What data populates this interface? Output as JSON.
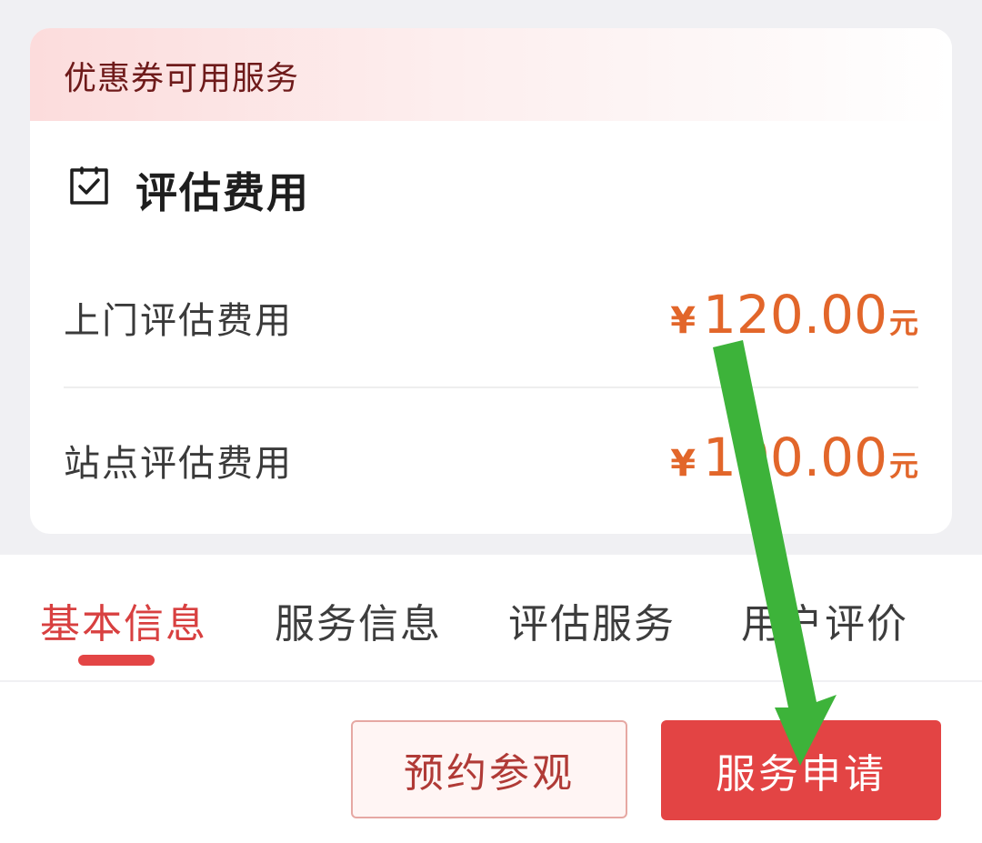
{
  "coupon_section": {
    "title": "优惠券可用服务"
  },
  "fee_section": {
    "icon": "checkbox-checked-icon",
    "title": "评估费用",
    "rows": [
      {
        "label": "上门评估费用",
        "currency": "¥",
        "amount": "120.00",
        "unit": "元"
      },
      {
        "label": "站点评估费用",
        "currency": "¥",
        "amount": "100.00",
        "unit": "元"
      }
    ]
  },
  "tabs": [
    {
      "label": "基本信息",
      "active": true
    },
    {
      "label": "服务信息",
      "active": false
    },
    {
      "label": "评估服务",
      "active": false
    },
    {
      "label": "用户评价",
      "active": false
    }
  ],
  "actions": {
    "visit_label": "预约参观",
    "apply_label": "服务申请"
  },
  "annotation": {
    "type": "arrow",
    "color": "#3db33a",
    "points_to": "apply-button"
  },
  "colors": {
    "accent_red": "#e34444",
    "price_orange": "#e2662a",
    "coupon_title": "#6e1a1a"
  }
}
